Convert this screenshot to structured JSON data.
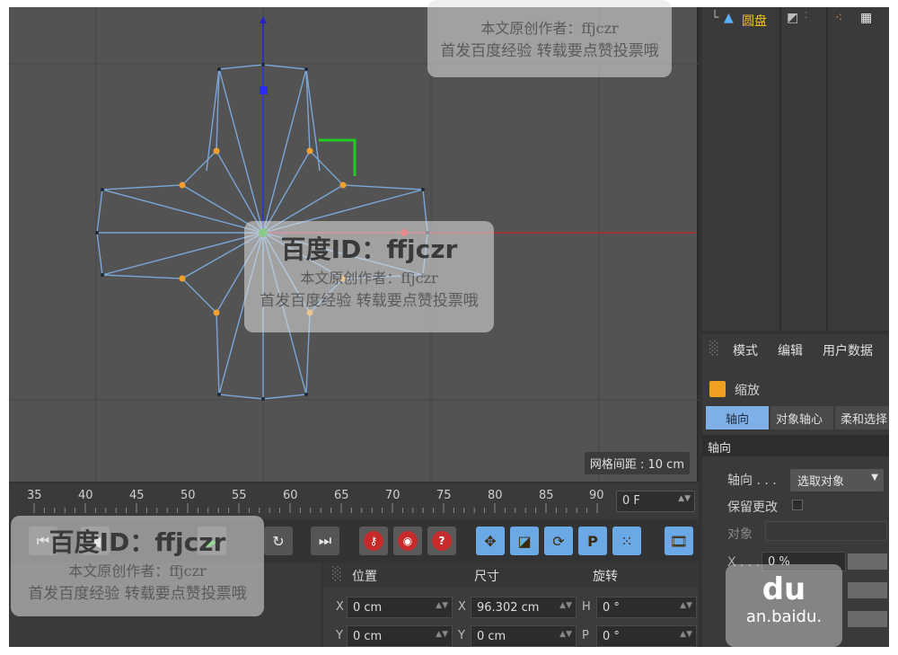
{
  "viewport": {
    "grid_spacing_label": "网格间距 : 10 cm"
  },
  "timeline": {
    "ticks": [
      "35",
      "40",
      "45",
      "50",
      "55",
      "60",
      "65",
      "70",
      "75",
      "80",
      "85",
      "90"
    ],
    "current_frame": "0 F"
  },
  "coords": {
    "position_label": "位置",
    "size_label": "尺寸",
    "rotation_label": "旋转",
    "rows": [
      {
        "axis_pos": "X",
        "pos": "0 cm",
        "axis_size": "X",
        "size": "96.302 cm",
        "axis_rot": "H",
        "rot": "0 °"
      },
      {
        "axis_pos": "Y",
        "pos": "0 cm",
        "axis_size": "Y",
        "size": "0 cm",
        "axis_rot": "P",
        "rot": "0 °"
      }
    ]
  },
  "objects": {
    "item_label": "圆盘"
  },
  "attributes": {
    "menu": [
      "模式",
      "编辑",
      "用户数据"
    ],
    "tool_name": "缩放",
    "tabs": [
      "轴向",
      "对象轴心",
      "柔和选择"
    ],
    "section_title": "轴向",
    "axis_label": "轴向 . . .",
    "axis_value": "选取对象",
    "keep_changes_label": "保留更改",
    "object_label": "对象",
    "x_label": "X . . .",
    "x_value": "0 %"
  },
  "watermarks": {
    "brand": "百度ID：ffjczr",
    "line1": "本文原创作者：ffjczr",
    "line2": "首发百度经验  转载要点赞投票哦",
    "brand_small": "百度ID：ffjczr",
    "baidu_logo": "du",
    "baidu_url": "an.baidu."
  },
  "colors": {
    "viewport_bg": "#535353",
    "mesh_edge": "#7aa6d8",
    "point": "#f0a030",
    "axis_x": "#cc2222",
    "axis_y": "#2222cc",
    "accent_tab": "#7fb0e8"
  }
}
